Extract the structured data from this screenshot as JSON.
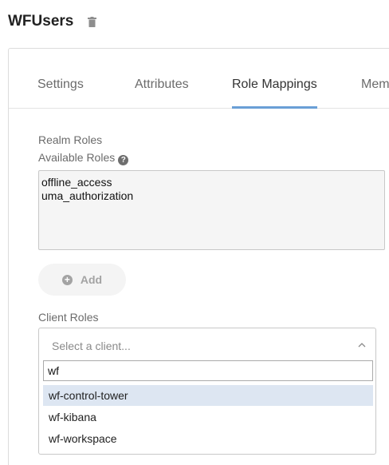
{
  "header": {
    "title": "WFUsers",
    "delete_icon": "trash-icon"
  },
  "tabs": [
    {
      "label": "Settings",
      "active": false
    },
    {
      "label": "Attributes",
      "active": false
    },
    {
      "label": "Role Mappings",
      "active": true
    },
    {
      "label": "Mem",
      "active": false
    }
  ],
  "realm_roles": {
    "heading": "Realm Roles",
    "available_label": "Available Roles",
    "help_icon": "question-circle-icon",
    "available": [
      "offline_access",
      "uma_authorization"
    ],
    "add_label": "Add"
  },
  "client_roles": {
    "heading": "Client Roles",
    "select_placeholder": "Select a client...",
    "search_value": "wf",
    "options": [
      "wf-control-tower",
      "wf-kibana",
      "wf-workspace"
    ],
    "highlighted_index": 0
  },
  "colors": {
    "accent": "#6a9fd6",
    "highlight": "#dde6f2"
  }
}
